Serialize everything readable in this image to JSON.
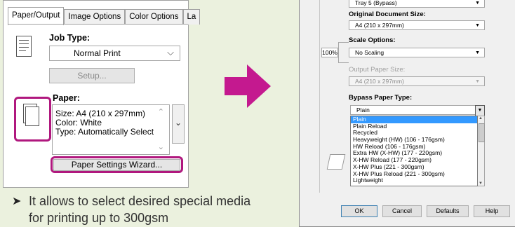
{
  "left": {
    "tabs": [
      "Paper/Output",
      "Image Options",
      "Color Options",
      "La"
    ],
    "job_type_label": "Job Type:",
    "job_type_value": "Normal Print",
    "setup_button": "Setup...",
    "paper_label": "Paper:",
    "paper_lines": [
      "Size: A4 (210 x 297mm)",
      "Color: White",
      "Type: Automatically Select"
    ],
    "wizard_button": "Paper Settings Wizard..."
  },
  "caption": {
    "bullet": "➤",
    "lines": [
      "It allows to select desired special media",
      "for printing up to 300gsm"
    ]
  },
  "right": {
    "top_value": "Tray 5 (Bypass)",
    "original_size_label": "Original Document Size:",
    "original_size_value": "A4 (210 x 297mm)",
    "scale_label": "Scale Options:",
    "scale_percent": "100%",
    "scale_value": "No Scaling",
    "output_size_label": "Output Paper Size:",
    "output_size_value": "A4 (210 x 297mm)",
    "bypass_label": "Bypass Paper Type:",
    "bypass_value": "Plain",
    "bypass_options": [
      "Plain",
      "Plain Reload",
      "Recycled",
      "Heavyweight (HW) (106 - 176gsm)",
      "HW Reload (106 - 176gsm)",
      "Extra HW (X-HW) (177 - 220gsm)",
      "X-HW Reload (177 - 220gsm)",
      "X-HW Plus (221 - 300gsm)",
      "X-HW Plus Reload (221 - 300gsm)",
      "Lightweight"
    ],
    "buttons": {
      "ok": "OK",
      "cancel": "Cancel",
      "defaults": "Defaults",
      "help": "Help"
    }
  },
  "colors": {
    "highlight": "#b0187e",
    "arrow": "#c4198f",
    "selected": "#3399ff",
    "background": "#ebf1de"
  }
}
